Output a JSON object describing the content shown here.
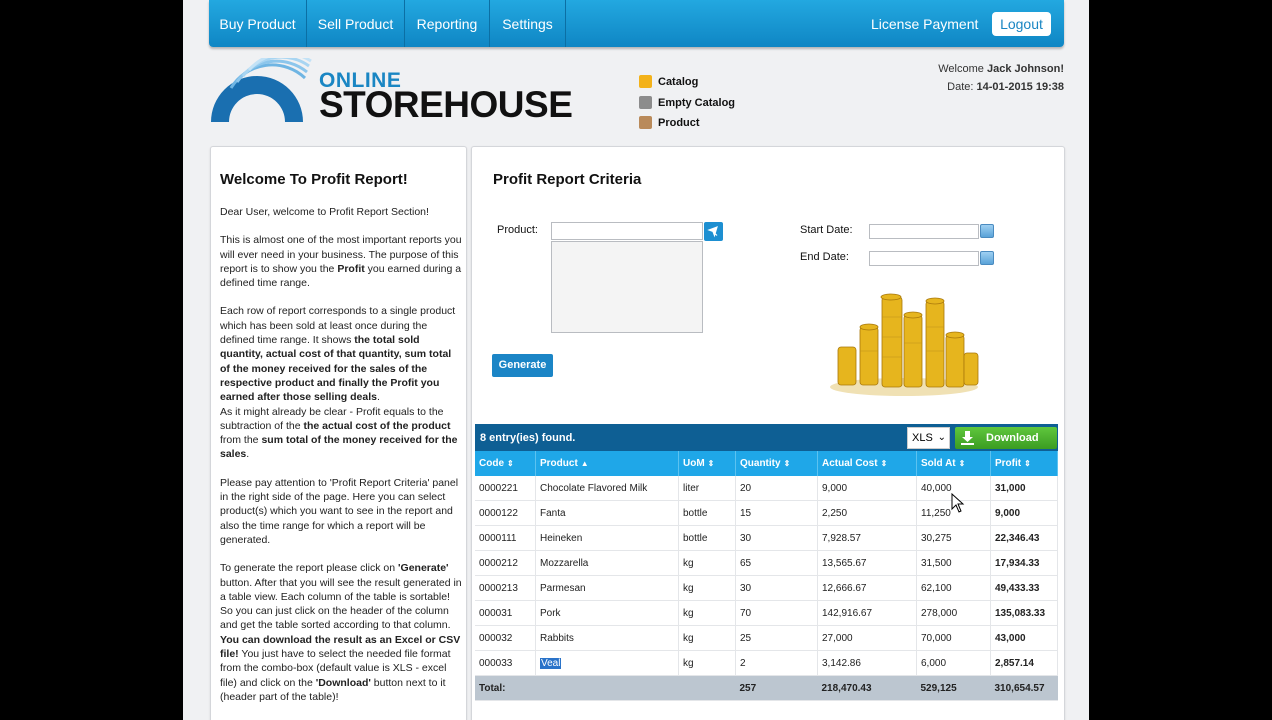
{
  "nav": {
    "items": [
      "Buy Product",
      "Sell Product",
      "Reporting",
      "Settings"
    ],
    "license": "License Payment",
    "logout": "Logout"
  },
  "logo": {
    "online": "ONLINE",
    "storehouse": "STOREHOUSE"
  },
  "quicklinks": [
    {
      "label": "Catalog",
      "icon": "catalog-icon",
      "color": "#f3b21a"
    },
    {
      "label": "Empty Catalog",
      "icon": "empty-catalog-icon",
      "color": "#8c8c8c"
    },
    {
      "label": "Product",
      "icon": "product-icon",
      "color": "#b98a5a"
    }
  ],
  "user": {
    "welcome_prefix": "Welcome",
    "name": "Jack Johnson!",
    "date_label": "Date:",
    "date": "14-01-2015 19:38"
  },
  "left": {
    "title": "Welcome To Profit Report!",
    "p1": "Dear User, welcome to Profit Report Section!",
    "p2a": "This is almost one of the most important reports you will ever need in your business. The purpose of this report is to show you the ",
    "p2b": "Profit",
    "p2c": " you earned during a defined time range.",
    "p3a": "Each row of report corresponds to a single product which has been sold at least once during the defined time range. It shows ",
    "p3b": "the total sold quantity, actual cost of that quantity, sum total of the money received for the sales of the respective product and finally the Profit you earned after those selling deals",
    "p3c": ".",
    "p4a": "As it might already be clear - Profit equals to the subtraction of the ",
    "p4b": "the actual cost of the product",
    "p4c": " from the ",
    "p4d": "sum total of the money received for the sales",
    "p4e": ".",
    "p5": "Please pay attention to 'Profit Report Criteria' panel in the right side of the page. Here you can select product(s) which you want to see in the report and also the time range for which a report will be generated.",
    "p6a": "To generate the report please click on ",
    "p6b": "'Generate'",
    "p6c": " button. After that you will see the result generated in a table view. Each column of the table is sortable! So you can just click on the header of the column and get the table sorted according to that column.",
    "p7a": "You can download the result as an Excel or CSV file!",
    "p7b": " You just have to select the needed file format from the combo-box (default value is XLS - excel file) and click on the ",
    "p7c": "'Download'",
    "p7d": " button next to it (header part of the table)!"
  },
  "criteria": {
    "title": "Profit Report Criteria",
    "product_label": "Product:",
    "start_label": "Start Date:",
    "end_label": "End Date:",
    "generate": "Generate"
  },
  "table": {
    "count": "8 entry(ies) found.",
    "format": "XLS",
    "download": "Download",
    "headers": [
      "Code",
      "Product",
      "UoM",
      "Quantity",
      "Actual Cost",
      "Sold At",
      "Profit"
    ],
    "rows": [
      [
        "0000221",
        "Chocolate Flavored Milk",
        "liter",
        "20",
        "9,000",
        "40,000",
        "31,000"
      ],
      [
        "0000122",
        "Fanta",
        "bottle",
        "15",
        "2,250",
        "11,250",
        "9,000"
      ],
      [
        "0000111",
        "Heineken",
        "bottle",
        "30",
        "7,928.57",
        "30,275",
        "22,346.43"
      ],
      [
        "0000212",
        "Mozzarella",
        "kg",
        "65",
        "13,565.67",
        "31,500",
        "17,934.33"
      ],
      [
        "0000213",
        "Parmesan",
        "kg",
        "30",
        "12,666.67",
        "62,100",
        "49,433.33"
      ],
      [
        "000031",
        "Pork",
        "kg",
        "70",
        "142,916.67",
        "278,000",
        "135,083.33"
      ],
      [
        "000032",
        "Rabbits",
        "kg",
        "25",
        "27,000",
        "70,000",
        "43,000"
      ],
      [
        "000033",
        "Veal",
        "kg",
        "2",
        "3,142.86",
        "6,000",
        "2,857.14"
      ]
    ],
    "total": {
      "label": "Total:",
      "quantity": "257",
      "cost": "218,470.43",
      "sold": "529,125",
      "profit": "310,654.57"
    }
  },
  "colors": {
    "brand": "#1a86c3",
    "nav": "#1796d3",
    "table_header": "#1fa7e8",
    "download": "#4cb22e"
  }
}
